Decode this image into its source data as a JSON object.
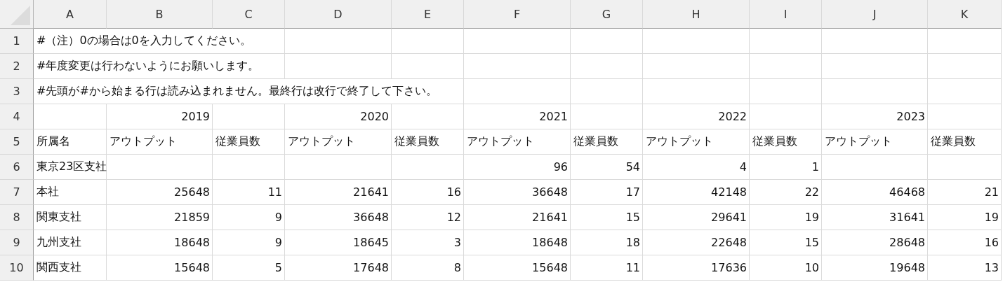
{
  "columns": [
    "A",
    "B",
    "C",
    "D",
    "E",
    "F",
    "G",
    "H",
    "I",
    "J",
    "K"
  ],
  "rows": [
    {
      "number": "1",
      "kind": "note",
      "text": "#（注）0の場合は0を入力してください。"
    },
    {
      "number": "2",
      "kind": "note",
      "text": "#年度変更は行わないようにお願いします。"
    },
    {
      "number": "3",
      "kind": "note",
      "text": "#先頭が#から始まる行は読み込まれません。最終行は改行で終了して下さい。"
    },
    {
      "number": "4",
      "kind": "values",
      "cells": [
        null,
        "2019",
        null,
        "2020",
        null,
        "2021",
        null,
        "2022",
        null,
        "2023",
        null
      ]
    },
    {
      "number": "5",
      "kind": "header",
      "cells": [
        "所属名",
        "アウトプット",
        "従業員数",
        "アウトプット",
        "従業員数",
        "アウトプット",
        "従業員数",
        "アウトプット",
        "従業員数",
        "アウトプット",
        "従業員数"
      ]
    },
    {
      "number": "6",
      "kind": "values",
      "cells": [
        "東京23区支社",
        null,
        null,
        null,
        null,
        "96",
        "54",
        "4",
        "1",
        null,
        null
      ]
    },
    {
      "number": "7",
      "kind": "values",
      "cells": [
        "本社",
        "25648",
        "11",
        "21641",
        "16",
        "36648",
        "17",
        "42148",
        "22",
        "46468",
        "21"
      ]
    },
    {
      "number": "8",
      "kind": "values",
      "cells": [
        "関東支社",
        "21859",
        "9",
        "36648",
        "12",
        "21641",
        "15",
        "29641",
        "19",
        "31641",
        "19"
      ]
    },
    {
      "number": "9",
      "kind": "values",
      "cells": [
        "九州支社",
        "18648",
        "9",
        "18645",
        "3",
        "18648",
        "18",
        "22648",
        "15",
        "28648",
        "16"
      ]
    },
    {
      "number": "10",
      "kind": "values",
      "cells": [
        "関西支社",
        "15648",
        "5",
        "17648",
        "8",
        "15648",
        "11",
        "17636",
        "10",
        "19648",
        "13"
      ]
    }
  ]
}
